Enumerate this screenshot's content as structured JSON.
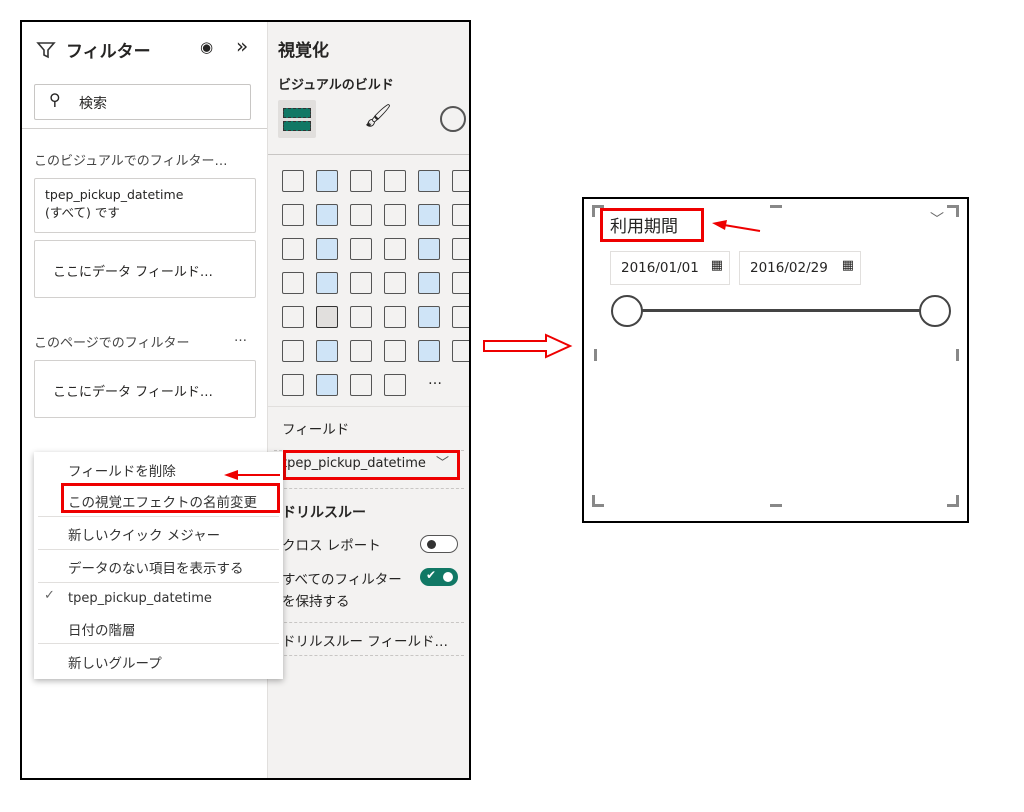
{
  "filters_pane": {
    "title": "フィルター",
    "search_placeholder": "検索",
    "visual_section": "このビジュアルでのフィルター…",
    "visual_filter_field": "tpep_pickup_datetime",
    "visual_filter_value": "(すべて) です",
    "drop_field": "ここにデータ フィールド…",
    "page_section": "このページでのフィルター",
    "more": "…"
  },
  "viz_pane": {
    "title": "視覚化",
    "build_label": "ビジュアルのビルド",
    "more_visuals": "…",
    "fields_label": "フィールド",
    "field_value": "tpep_pickup_datetime",
    "drillthrough_label": "ドリルスルー",
    "cross_report": "クロス レポート",
    "cross_report_on": false,
    "keep_filters_1": "すべてのフィルター",
    "keep_filters_2": "を保持する",
    "keep_filters_on": true,
    "drill_field": "ドリルスルー フィールド…"
  },
  "context_menu": {
    "items": [
      "フィールドを削除",
      "この視覚エフェクトの名前変更",
      "新しいクイック メジャー",
      "データのない項目を表示する",
      "tpep_pickup_datetime",
      "日付の階層",
      "新しいグループ"
    ],
    "checked_item": "tpep_pickup_datetime"
  },
  "slicer": {
    "title": "利用期間",
    "start_date": "2016/01/01",
    "end_date": "2016/02/29",
    "range_fraction": [
      0,
      1
    ]
  },
  "colors": {
    "accent": "#117865",
    "highlight": "#e00000"
  }
}
